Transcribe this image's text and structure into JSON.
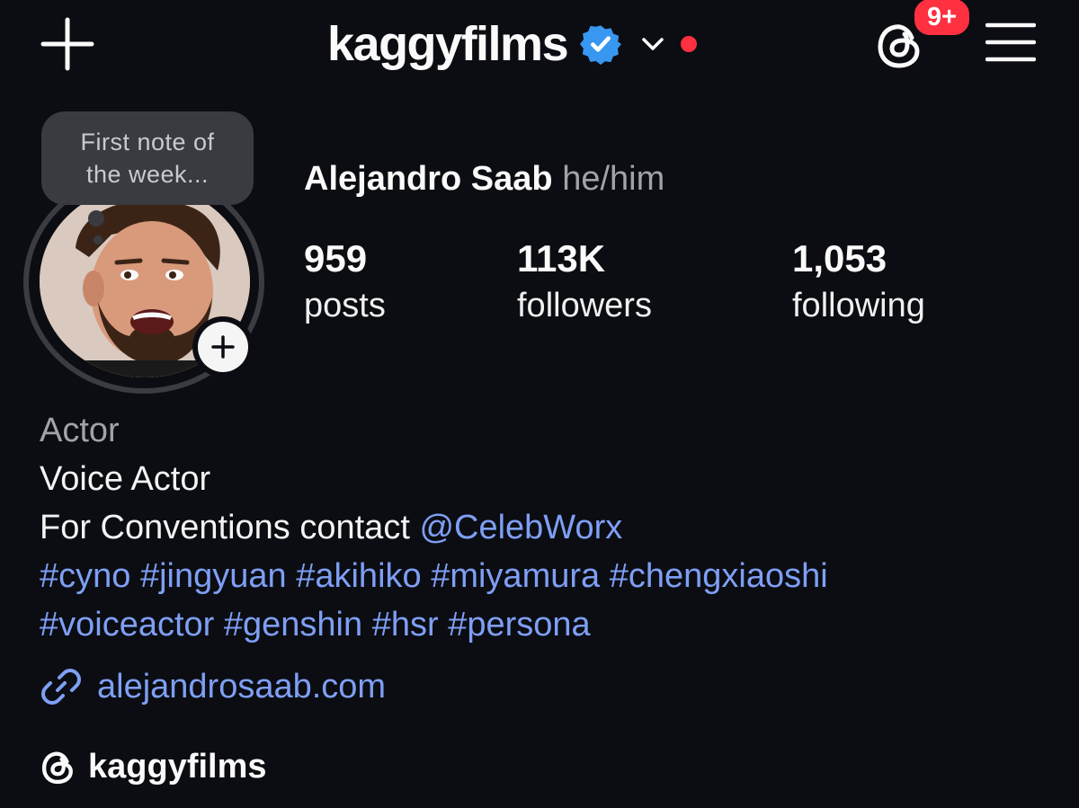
{
  "header": {
    "username": "kaggyfilms",
    "notification_badge": "9+",
    "accent_color": "#3897f0",
    "dot_color": "#ff3040"
  },
  "note": {
    "text_line1": "First note of",
    "text_line2": "the week..."
  },
  "profile": {
    "full_name": "Alejandro Saab",
    "pronouns": "he/him"
  },
  "stats": [
    {
      "value": "959",
      "label": "posts"
    },
    {
      "value": "113K",
      "label": "followers"
    },
    {
      "value": "1,053",
      "label": "following"
    }
  ],
  "bio": {
    "category": "Actor",
    "line1": "Voice Actor",
    "line2_prefix": "For Conventions contact ",
    "mention": "@CelebWorx",
    "hashtags_line1": [
      "#cyno",
      "#jingyuan",
      "#akihiko",
      "#miyamura",
      "#chengxiaoshi"
    ],
    "hashtags_line2": [
      "#voiceactor",
      "#genshin",
      "#hsr",
      "#persona"
    ],
    "website": "alejandrosaab.com",
    "threads_handle": "kaggyfilms",
    "link_color": "#7f9ff5"
  }
}
